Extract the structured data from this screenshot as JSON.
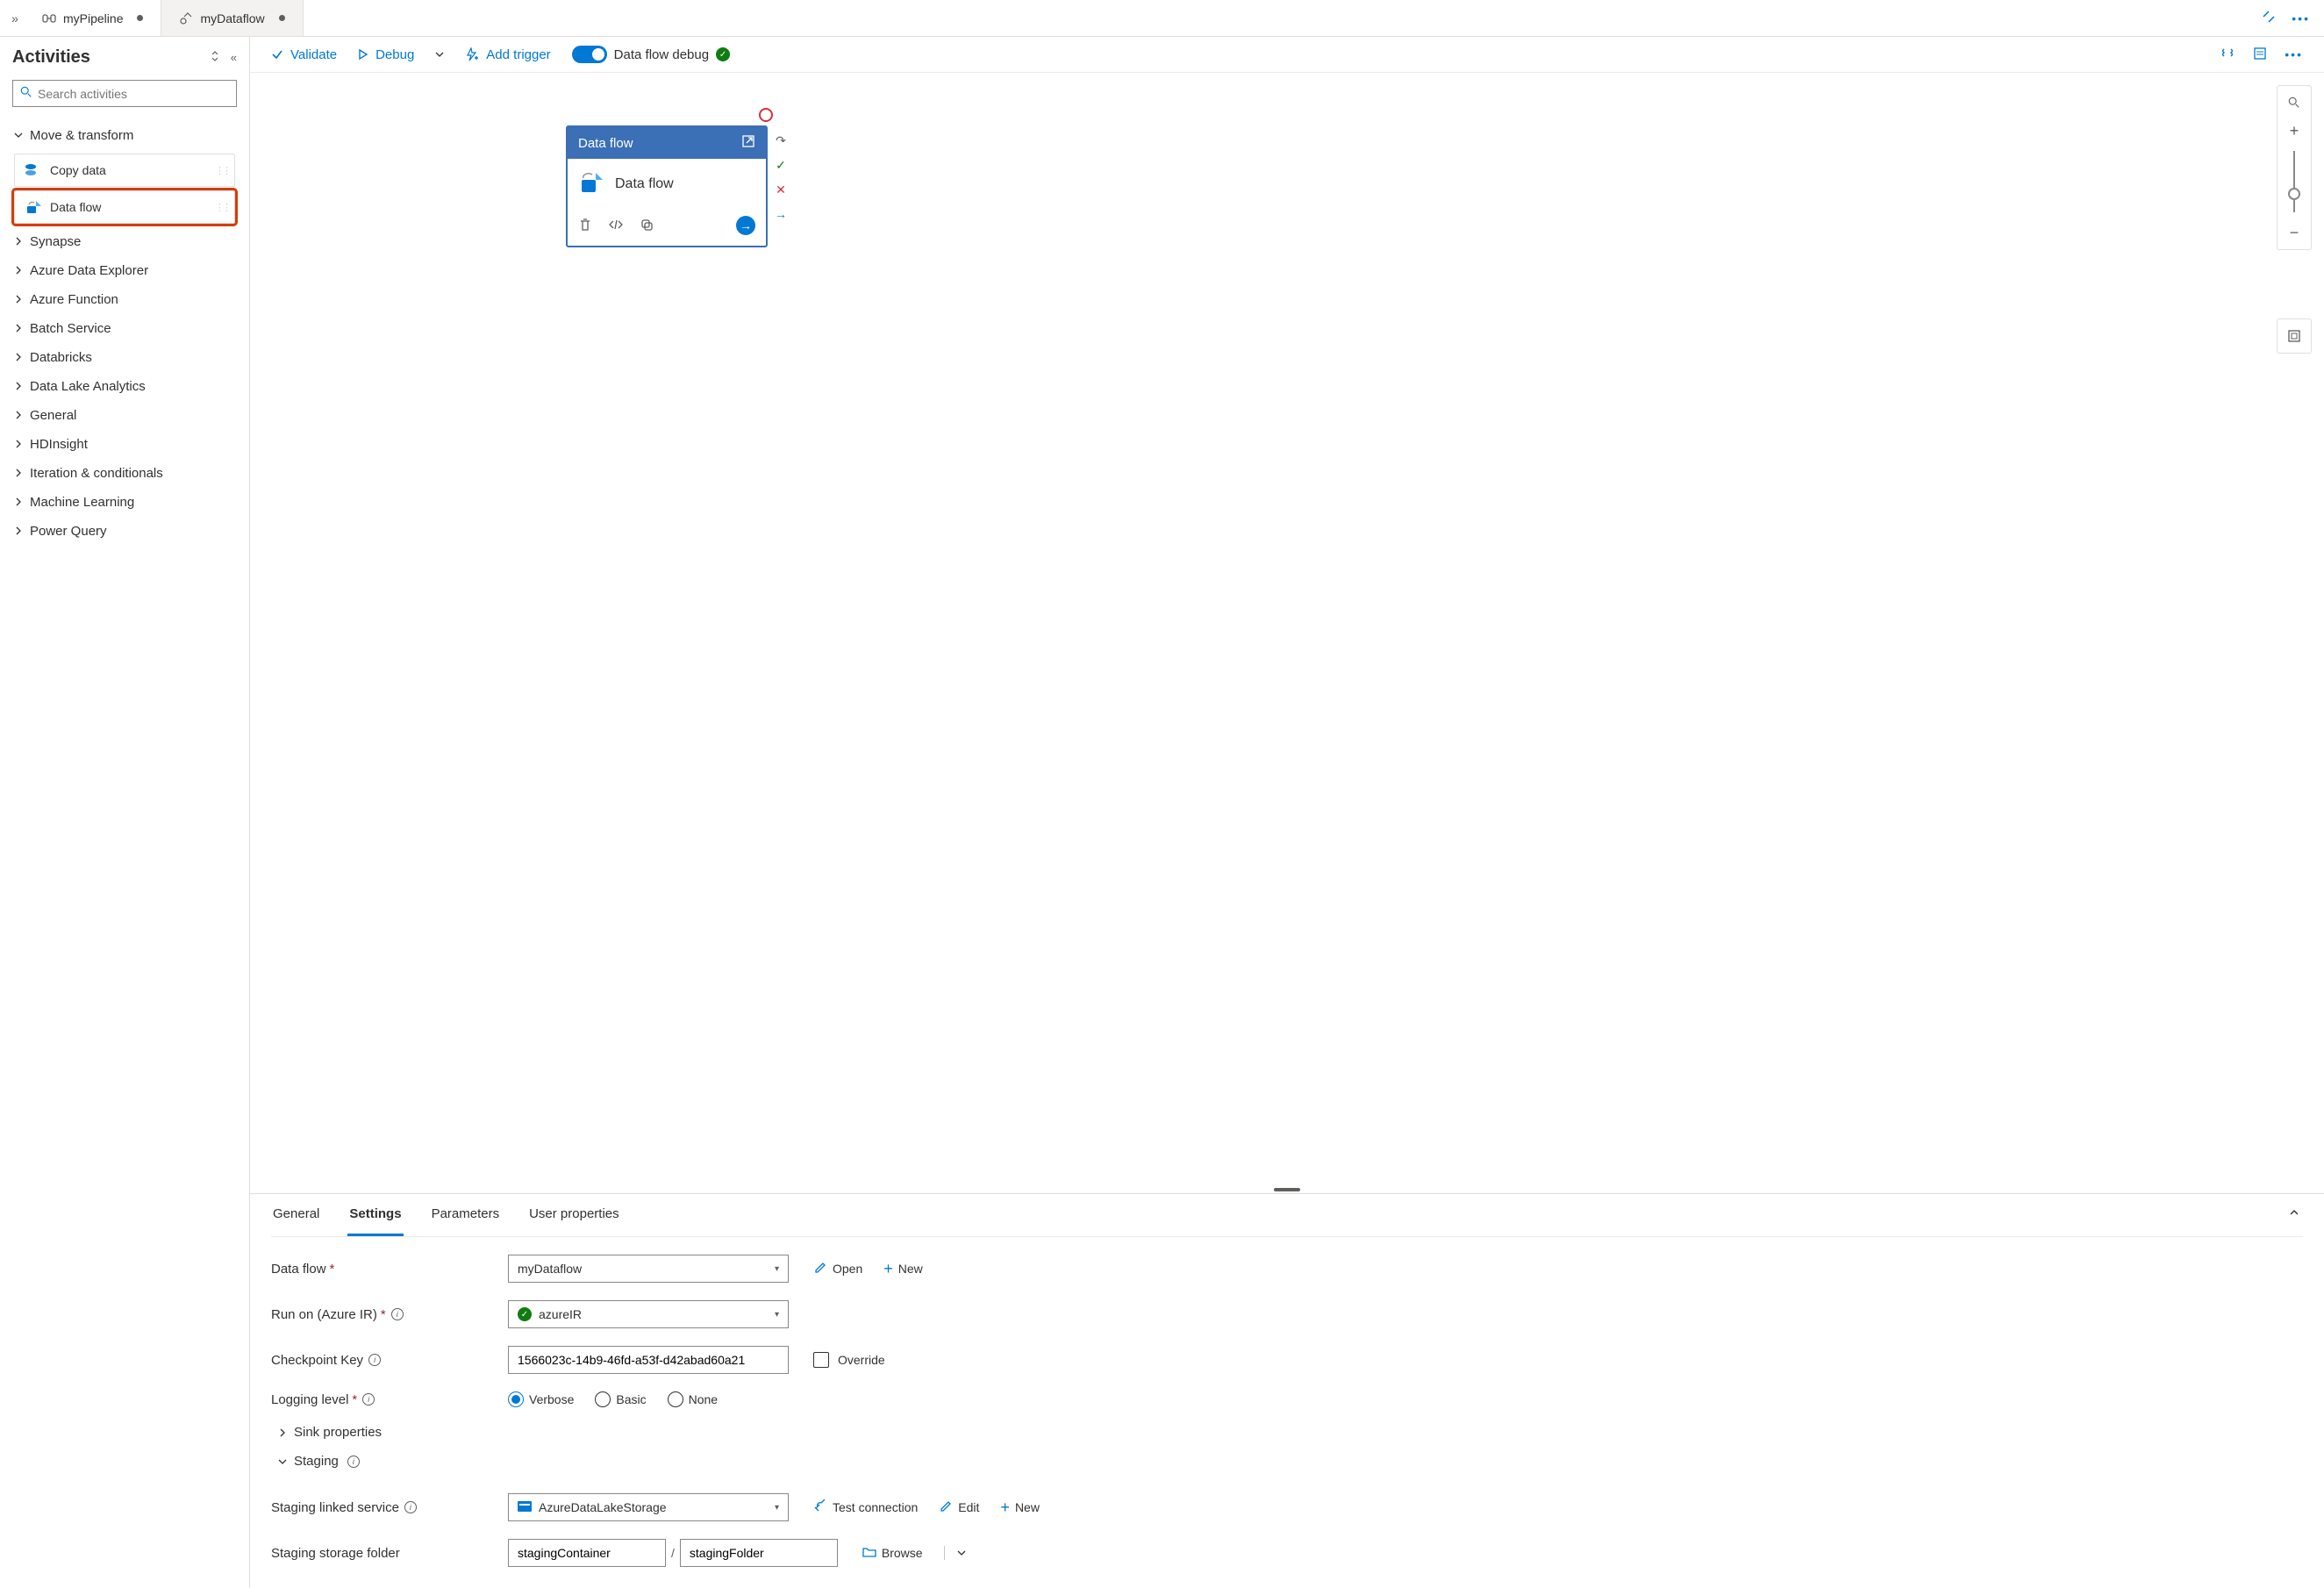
{
  "tabs": [
    {
      "label": "myPipeline",
      "dirty": true
    },
    {
      "label": "myDataflow",
      "dirty": true
    }
  ],
  "sidebar": {
    "title": "Activities",
    "search_placeholder": "Search activities",
    "expanded_category": "Move & transform",
    "items": [
      {
        "label": "Copy data"
      },
      {
        "label": "Data flow"
      }
    ],
    "categories": [
      "Synapse",
      "Azure Data Explorer",
      "Azure Function",
      "Batch Service",
      "Databricks",
      "Data Lake Analytics",
      "General",
      "HDInsight",
      "Iteration & conditionals",
      "Machine Learning",
      "Power Query"
    ]
  },
  "toolbar": {
    "validate": "Validate",
    "debug": "Debug",
    "add_trigger": "Add trigger",
    "debug_toggle": "Data flow debug"
  },
  "node": {
    "header": "Data flow",
    "body": "Data flow"
  },
  "props": {
    "tabs": [
      "General",
      "Settings",
      "Parameters",
      "User properties"
    ],
    "active_tab": "Settings",
    "dataflow_label": "Data flow",
    "dataflow_value": "myDataflow",
    "runon_label": "Run on (Azure IR)",
    "runon_value": "azureIR",
    "checkpoint_label": "Checkpoint Key",
    "checkpoint_value": "1566023c-14b9-46fd-a53f-d42abad60a21",
    "override_label": "Override",
    "logging_label": "Logging level",
    "logging_options": [
      "Verbose",
      "Basic",
      "None"
    ],
    "logging_selected": "Verbose",
    "sink_label": "Sink properties",
    "staging_label": "Staging",
    "staging_service_label": "Staging linked service",
    "staging_service_value": "AzureDataLakeStorage",
    "staging_folder_label": "Staging storage folder",
    "staging_container": "stagingContainer",
    "staging_folder": "stagingFolder",
    "open": "Open",
    "new": "New",
    "edit": "Edit",
    "test_connection": "Test connection",
    "browse": "Browse"
  }
}
